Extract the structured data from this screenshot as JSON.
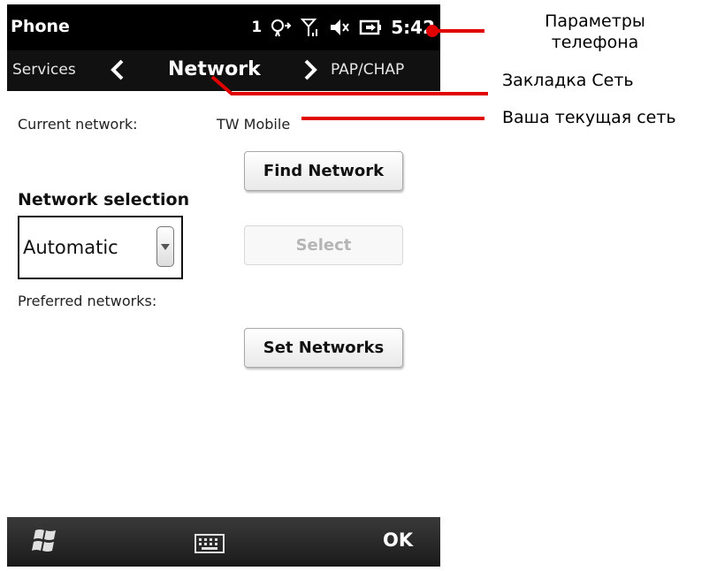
{
  "status_bar": {
    "app_title": "Phone",
    "sim_number": "1",
    "time": "5:42",
    "icons": [
      "roaming-signal-icon",
      "cellular-signal-icon",
      "speaker-muted-icon",
      "battery-charging-icon"
    ]
  },
  "tabs": {
    "previous": "Services",
    "current": "Network",
    "next": "PAP/CHAP"
  },
  "network": {
    "current_network_label": "Current network:",
    "current_network_value": "TW Mobile",
    "find_network_label": "Find Network",
    "network_selection_label": "Network selection",
    "selection_value": "Automatic",
    "select_label": "Select",
    "preferred_networks_label": "Preferred networks:",
    "set_networks_label": "Set Networks"
  },
  "bottom_bar": {
    "ok_label": "OK",
    "icons": [
      "windows-start-icon",
      "keyboard-icon"
    ]
  },
  "annotations": {
    "phone_settings": "Параметры\nтелефона",
    "network_tab": "Закладка Сеть",
    "current_network": "Ваша текущая сеть"
  },
  "colors": {
    "callout_line": "#e00000",
    "status_bar": "#000000",
    "disabled_text": "#b5b5b5"
  }
}
